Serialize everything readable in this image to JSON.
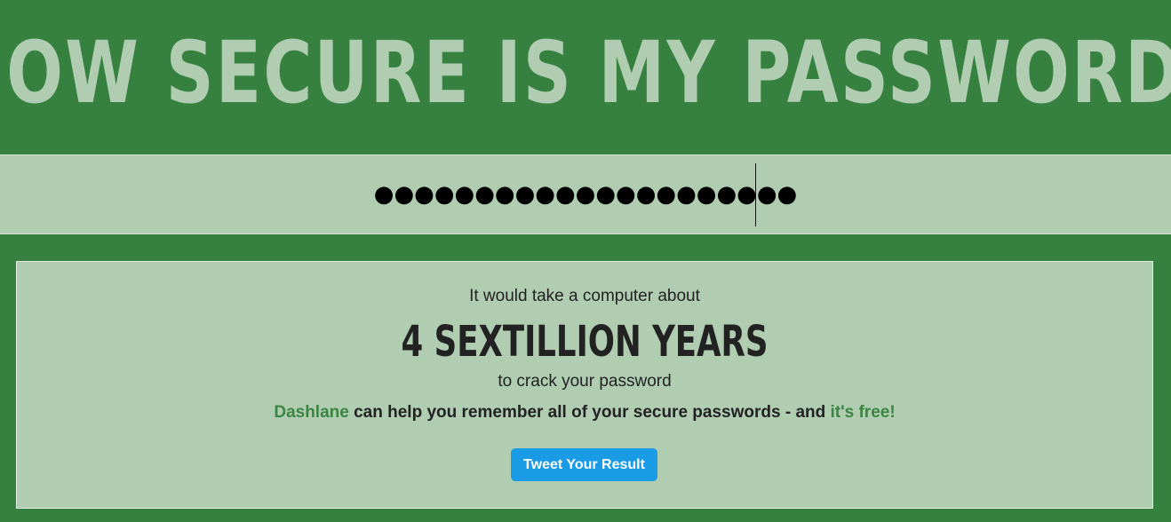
{
  "header": {
    "title": "HOW SECURE IS MY PASSWORD?"
  },
  "password_field": {
    "value": "●●●●●●●●●●●●●●●●●●●●●"
  },
  "result": {
    "intro": "It would take a computer about",
    "time": "4 SEXTILLION YEARS",
    "suffix": "to crack your password",
    "promo_brand": "Dashlane",
    "promo_text": " can help you remember all of your secure passwords - and ",
    "promo_free": "it's free!",
    "tweet_label": "Tweet Your Result"
  },
  "colors": {
    "background": "#378140",
    "panel": "#b0cdb2",
    "title": "#b0cdb2",
    "link": "#3b8441",
    "tweet_button": "#1a9be6"
  }
}
